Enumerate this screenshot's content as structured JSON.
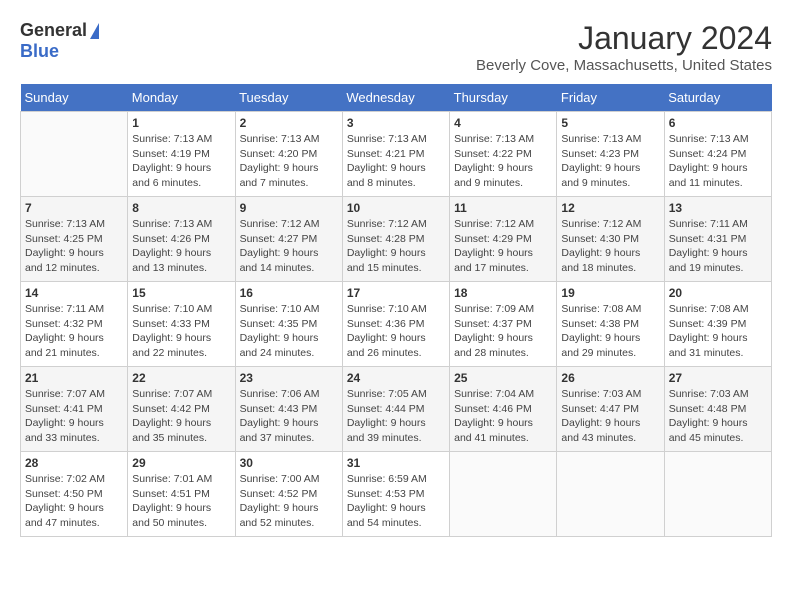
{
  "header": {
    "logo_general": "General",
    "logo_blue": "Blue",
    "title": "January 2024",
    "subtitle": "Beverly Cove, Massachusetts, United States"
  },
  "columns": [
    "Sunday",
    "Monday",
    "Tuesday",
    "Wednesday",
    "Thursday",
    "Friday",
    "Saturday"
  ],
  "weeks": [
    [
      {
        "day": "",
        "info": ""
      },
      {
        "day": "1",
        "info": "Sunrise: 7:13 AM\nSunset: 4:19 PM\nDaylight: 9 hours\nand 6 minutes."
      },
      {
        "day": "2",
        "info": "Sunrise: 7:13 AM\nSunset: 4:20 PM\nDaylight: 9 hours\nand 7 minutes."
      },
      {
        "day": "3",
        "info": "Sunrise: 7:13 AM\nSunset: 4:21 PM\nDaylight: 9 hours\nand 8 minutes."
      },
      {
        "day": "4",
        "info": "Sunrise: 7:13 AM\nSunset: 4:22 PM\nDaylight: 9 hours\nand 9 minutes."
      },
      {
        "day": "5",
        "info": "Sunrise: 7:13 AM\nSunset: 4:23 PM\nDaylight: 9 hours\nand 9 minutes."
      },
      {
        "day": "6",
        "info": "Sunrise: 7:13 AM\nSunset: 4:24 PM\nDaylight: 9 hours\nand 11 minutes."
      }
    ],
    [
      {
        "day": "7",
        "info": "Sunrise: 7:13 AM\nSunset: 4:25 PM\nDaylight: 9 hours\nand 12 minutes."
      },
      {
        "day": "8",
        "info": "Sunrise: 7:13 AM\nSunset: 4:26 PM\nDaylight: 9 hours\nand 13 minutes."
      },
      {
        "day": "9",
        "info": "Sunrise: 7:12 AM\nSunset: 4:27 PM\nDaylight: 9 hours\nand 14 minutes."
      },
      {
        "day": "10",
        "info": "Sunrise: 7:12 AM\nSunset: 4:28 PM\nDaylight: 9 hours\nand 15 minutes."
      },
      {
        "day": "11",
        "info": "Sunrise: 7:12 AM\nSunset: 4:29 PM\nDaylight: 9 hours\nand 17 minutes."
      },
      {
        "day": "12",
        "info": "Sunrise: 7:12 AM\nSunset: 4:30 PM\nDaylight: 9 hours\nand 18 minutes."
      },
      {
        "day": "13",
        "info": "Sunrise: 7:11 AM\nSunset: 4:31 PM\nDaylight: 9 hours\nand 19 minutes."
      }
    ],
    [
      {
        "day": "14",
        "info": "Sunrise: 7:11 AM\nSunset: 4:32 PM\nDaylight: 9 hours\nand 21 minutes."
      },
      {
        "day": "15",
        "info": "Sunrise: 7:10 AM\nSunset: 4:33 PM\nDaylight: 9 hours\nand 22 minutes."
      },
      {
        "day": "16",
        "info": "Sunrise: 7:10 AM\nSunset: 4:35 PM\nDaylight: 9 hours\nand 24 minutes."
      },
      {
        "day": "17",
        "info": "Sunrise: 7:10 AM\nSunset: 4:36 PM\nDaylight: 9 hours\nand 26 minutes."
      },
      {
        "day": "18",
        "info": "Sunrise: 7:09 AM\nSunset: 4:37 PM\nDaylight: 9 hours\nand 28 minutes."
      },
      {
        "day": "19",
        "info": "Sunrise: 7:08 AM\nSunset: 4:38 PM\nDaylight: 9 hours\nand 29 minutes."
      },
      {
        "day": "20",
        "info": "Sunrise: 7:08 AM\nSunset: 4:39 PM\nDaylight: 9 hours\nand 31 minutes."
      }
    ],
    [
      {
        "day": "21",
        "info": "Sunrise: 7:07 AM\nSunset: 4:41 PM\nDaylight: 9 hours\nand 33 minutes."
      },
      {
        "day": "22",
        "info": "Sunrise: 7:07 AM\nSunset: 4:42 PM\nDaylight: 9 hours\nand 35 minutes."
      },
      {
        "day": "23",
        "info": "Sunrise: 7:06 AM\nSunset: 4:43 PM\nDaylight: 9 hours\nand 37 minutes."
      },
      {
        "day": "24",
        "info": "Sunrise: 7:05 AM\nSunset: 4:44 PM\nDaylight: 9 hours\nand 39 minutes."
      },
      {
        "day": "25",
        "info": "Sunrise: 7:04 AM\nSunset: 4:46 PM\nDaylight: 9 hours\nand 41 minutes."
      },
      {
        "day": "26",
        "info": "Sunrise: 7:03 AM\nSunset: 4:47 PM\nDaylight: 9 hours\nand 43 minutes."
      },
      {
        "day": "27",
        "info": "Sunrise: 7:03 AM\nSunset: 4:48 PM\nDaylight: 9 hours\nand 45 minutes."
      }
    ],
    [
      {
        "day": "28",
        "info": "Sunrise: 7:02 AM\nSunset: 4:50 PM\nDaylight: 9 hours\nand 47 minutes."
      },
      {
        "day": "29",
        "info": "Sunrise: 7:01 AM\nSunset: 4:51 PM\nDaylight: 9 hours\nand 50 minutes."
      },
      {
        "day": "30",
        "info": "Sunrise: 7:00 AM\nSunset: 4:52 PM\nDaylight: 9 hours\nand 52 minutes."
      },
      {
        "day": "31",
        "info": "Sunrise: 6:59 AM\nSunset: 4:53 PM\nDaylight: 9 hours\nand 54 minutes."
      },
      {
        "day": "",
        "info": ""
      },
      {
        "day": "",
        "info": ""
      },
      {
        "day": "",
        "info": ""
      }
    ]
  ]
}
